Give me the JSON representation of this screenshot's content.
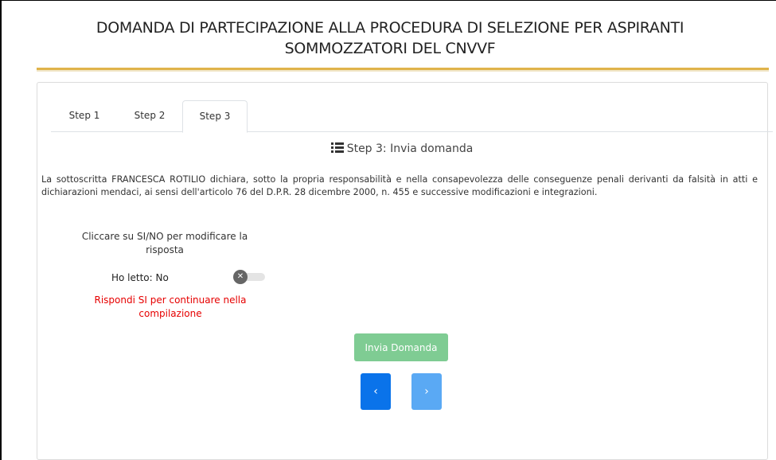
{
  "page": {
    "title_line1": "DOMANDA DI PARTECIPAZIONE ALLA PROCEDURA DI SELEZIONE PER ASPIRANTI",
    "title_line2": "SOMMOZZATORI DEL CNVVF"
  },
  "tabs": [
    {
      "label": "Step 1",
      "active": false
    },
    {
      "label": "Step 2",
      "active": false
    },
    {
      "label": "Step 3",
      "active": true
    }
  ],
  "step": {
    "icon": "list-icon",
    "heading": "Step 3: Invia domanda"
  },
  "declaration": {
    "text": "La sottoscritta FRANCESCA ROTILIO dichiara, sotto la propria responsabilità e nella consapevolezza delle conseguenze penali derivanti da falsità in atti e dichiarazioni mendaci, ai sensi dell'articolo 76 del D.P.R. 28 dicembre 2000, n. 455 e successive modificazioni e integrazioni."
  },
  "form": {
    "hint": "Cliccare su SI/NO per modificare la risposta",
    "toggle_label": "Ho letto: No",
    "toggle_icon": "close-icon",
    "toggle_state": "off",
    "error": "Rispondi SI per continuare nella compilazione"
  },
  "actions": {
    "submit_label": "Invia Domanda",
    "prev_label": "‹",
    "next_label": "›"
  },
  "colors": {
    "accent_rule": "#e0b34a",
    "submit": "#7fcc93",
    "prev": "#0a73ea",
    "next": "#5aa9f4",
    "error": "#e60000"
  }
}
